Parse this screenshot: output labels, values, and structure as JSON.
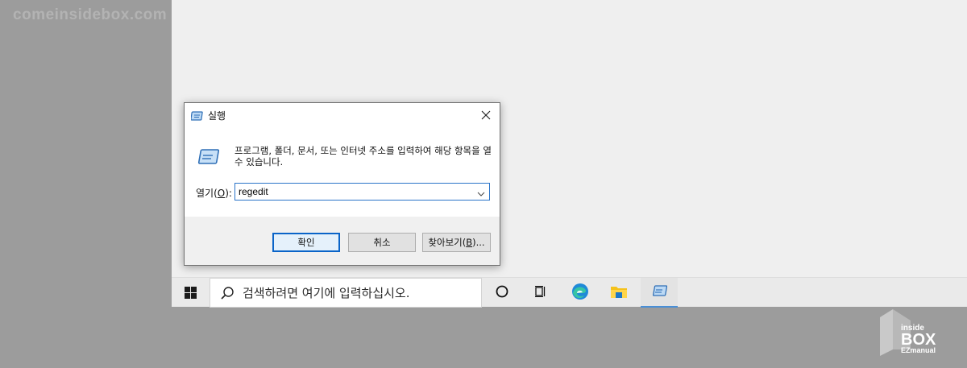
{
  "watermark": "comeinsidebox.com",
  "dialog": {
    "title": "실행",
    "description": "프로그램, 폴더, 문서, 또는 인터넷 주소를 입력하여 해당 항목을 열 수 있습니다.",
    "open_label_prefix": "열기(",
    "open_label_key": "O",
    "open_label_suffix": "):",
    "open_value": "regedit",
    "ok_label": "확인",
    "cancel_label": "취소",
    "browse_label_prefix": "찾아보기(",
    "browse_label_key": "B",
    "browse_label_suffix": ")..."
  },
  "taskbar": {
    "search_placeholder": "검색하려면 여기에 입력하십시오.",
    "icons": [
      "windows-start-icon",
      "cortana-icon",
      "task-view-icon",
      "edge-icon",
      "file-explorer-icon",
      "run-icon"
    ]
  },
  "corner_logo": {
    "line1": "inside",
    "line2": "BOX",
    "line3": "EZmanual"
  },
  "colors": {
    "accent": "#0a64c8",
    "taskbar": "#eaeaea",
    "outer_bg": "#9c9c9c"
  }
}
